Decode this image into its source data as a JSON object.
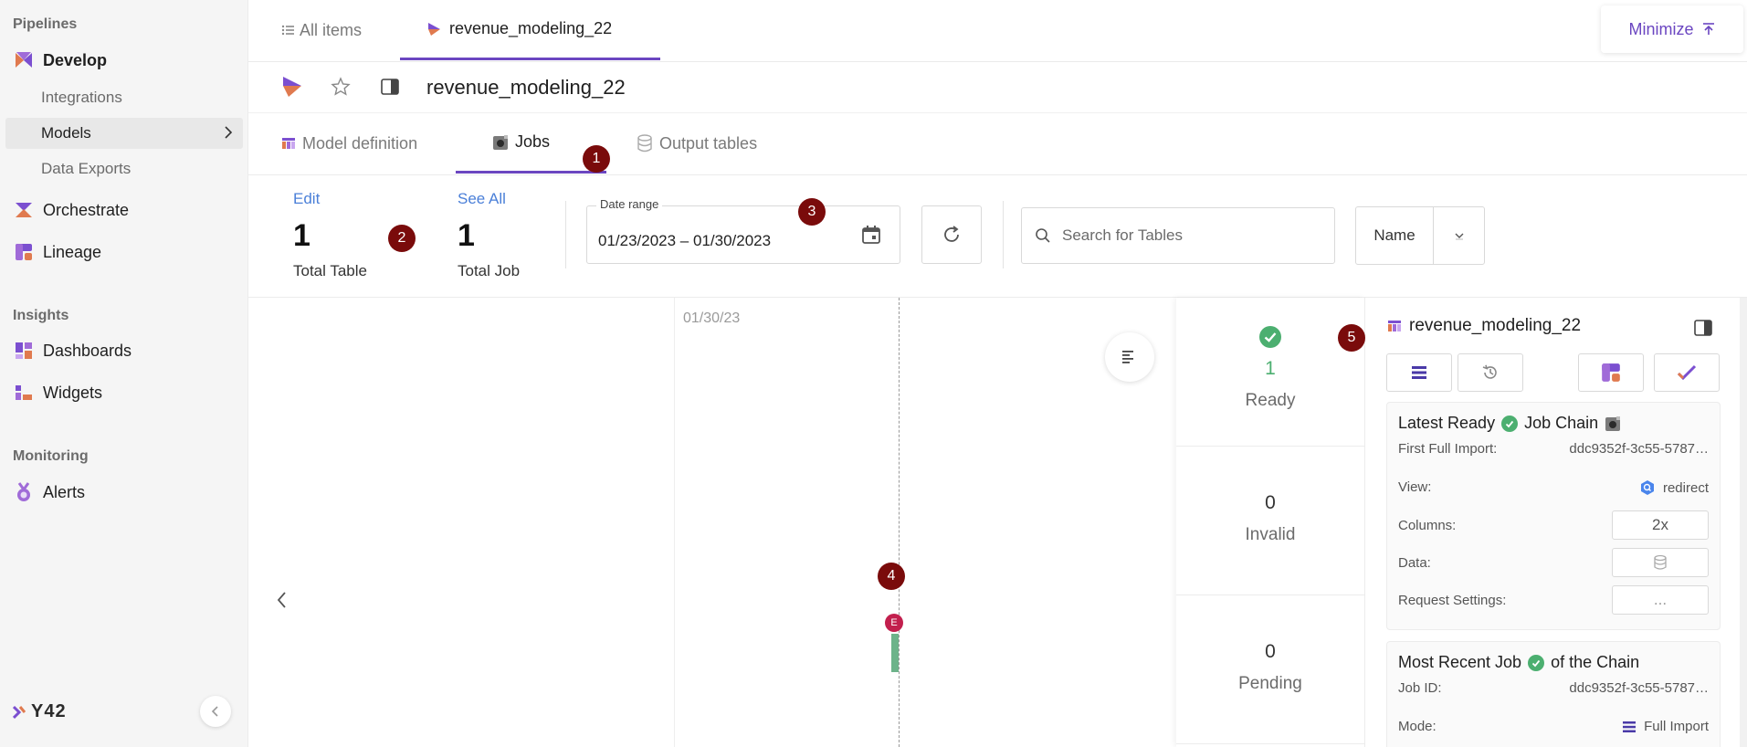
{
  "sidebar": {
    "sections": {
      "pipelines": "Pipelines",
      "insights": "Insights",
      "monitoring": "Monitoring"
    },
    "develop": "Develop",
    "integrations": "Integrations",
    "models": "Models",
    "data_exports": "Data Exports",
    "orchestrate": "Orchestrate",
    "lineage": "Lineage",
    "dashboards": "Dashboards",
    "widgets": "Widgets",
    "alerts": "Alerts",
    "logo": "Y42"
  },
  "top_tabs": {
    "all_items": "All items",
    "active_tab": "revenue_modeling_22",
    "minimize": "Minimize"
  },
  "title": "revenue_modeling_22",
  "sub_tabs": {
    "model_definition": "Model definition",
    "jobs": "Jobs",
    "output_tables": "Output tables"
  },
  "badges": [
    "1",
    "2",
    "3",
    "4",
    "5"
  ],
  "stats": {
    "edit": "Edit",
    "total_table_num": "1",
    "total_table_label": "Total Table",
    "see_all": "See All",
    "total_job_num": "1",
    "total_job_label": "Total Job"
  },
  "date_range": {
    "legend": "Date range",
    "value": "01/23/2023 – 01/30/2023"
  },
  "search": {
    "placeholder": "Search for Tables"
  },
  "sort": {
    "label": "Name"
  },
  "timeline": {
    "date": "01/30/23",
    "marker": "E"
  },
  "status": {
    "ready_num": "1",
    "ready_label": "Ready",
    "invalid_num": "0",
    "invalid_label": "Invalid",
    "pending_num": "0",
    "pending_label": "Pending"
  },
  "panel": {
    "title": "revenue_modeling_22",
    "latest_card": {
      "title_a": "Latest Ready",
      "title_b": "Job Chain",
      "first_full_import_label": "First Full Import:",
      "first_full_import_value": "ddc9352f-3c55-5787…",
      "view_label": "View:",
      "view_value": "redirect",
      "columns_label": "Columns:",
      "columns_value": "2x",
      "data_label": "Data:",
      "request_settings_label": "Request Settings:",
      "request_settings_value": "..."
    },
    "recent_card": {
      "title_a": "Most Recent Job",
      "title_b": "of the Chain",
      "job_id_label": "Job ID:",
      "job_id_value": "ddc9352f-3c55-5787…",
      "mode_label": "Mode:",
      "mode_value": "Full Import"
    }
  },
  "colors": {
    "accent": "#6b46c1",
    "link": "#4a7fd8",
    "badge": "#7a0b0b",
    "success": "#4caf70"
  }
}
